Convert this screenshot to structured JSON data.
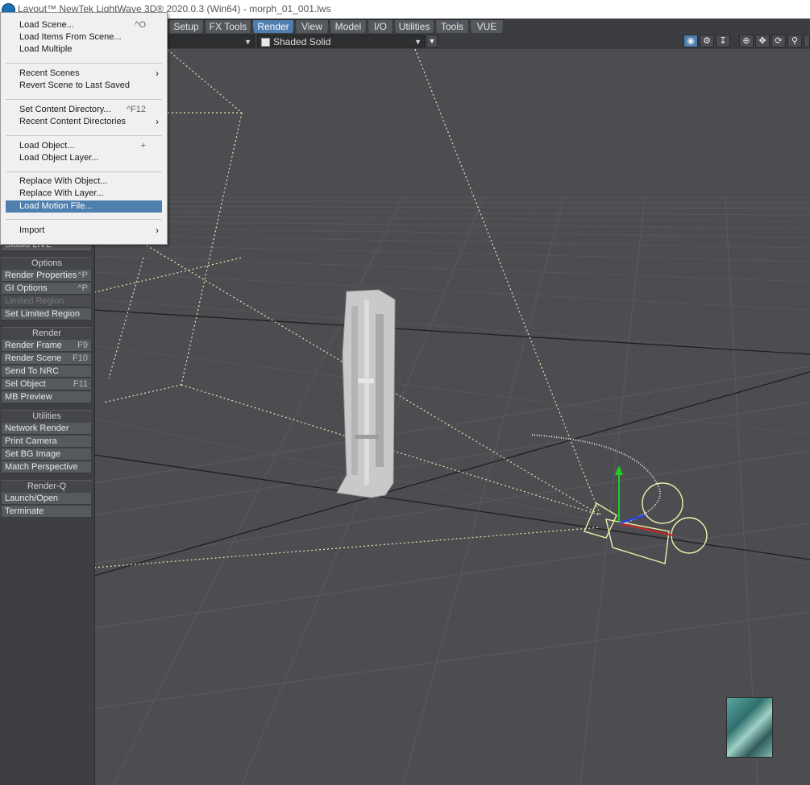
{
  "titlebar": {
    "title": "Layout™ NewTek LightWave 3D® 2020.0.3 (Win64) - morph_01_001.lws",
    "icon": "lightwave-logo-icon"
  },
  "tabs": [
    {
      "label": "Setup"
    },
    {
      "label": "FX Tools"
    },
    {
      "label": "Render"
    },
    {
      "label": "View"
    },
    {
      "label": "Model"
    },
    {
      "label": "I/O"
    },
    {
      "label": "Utilities"
    },
    {
      "label": "Tools"
    },
    {
      "label": "VUE"
    }
  ],
  "active_tab": "Render",
  "toolbar": {
    "view_select": "",
    "shading_select": "Shaded Solid",
    "icons": [
      "camera-render-icon",
      "gear-icon",
      "export-icon",
      "center-icon",
      "move-icon",
      "rotate-icon",
      "zoom-icon",
      "maximize-icon"
    ]
  },
  "menu": {
    "items": [
      {
        "label": "Load Scene...",
        "shortcut": "^O"
      },
      {
        "label": "Load Items From Scene...",
        "shortcut": ""
      },
      {
        "label": "Load Multiple",
        "shortcut": ""
      },
      {
        "label": "Recent Scenes",
        "shortcut": "",
        "submenu": true
      },
      {
        "label": "Revert Scene to Last Saved",
        "shortcut": ""
      },
      {
        "label": "Set Content Directory...",
        "shortcut": "^F12"
      },
      {
        "label": "Recent Content Directories",
        "shortcut": "",
        "submenu": true
      },
      {
        "label": "Load Object...",
        "shortcut": "+"
      },
      {
        "label": "Load Object Layer...",
        "shortcut": ""
      },
      {
        "label": "Replace With Object...",
        "shortcut": ""
      },
      {
        "label": "Replace With Layer...",
        "shortcut": ""
      },
      {
        "label": "Load Motion File...",
        "shortcut": ""
      },
      {
        "label": "Import",
        "shortcut": "",
        "submenu": true
      }
    ],
    "highlighted": "Load Motion File..."
  },
  "panel": {
    "partial_top": "Studio LIVE",
    "groups": [
      {
        "title": "Options",
        "buttons": [
          {
            "label": "Render Properties",
            "shortcut": "^P"
          },
          {
            "label": "GI Options",
            "shortcut": "^P"
          },
          {
            "label": "Limited Region",
            "shortcut": "",
            "disabled": true
          },
          {
            "label": "Set Limited Region",
            "shortcut": ""
          }
        ]
      },
      {
        "title": "Render",
        "buttons": [
          {
            "label": "Render Frame",
            "shortcut": "F9"
          },
          {
            "label": "Render Scene",
            "shortcut": "F10"
          },
          {
            "label": "Send To NRC",
            "shortcut": ""
          },
          {
            "label": "Sel Object",
            "shortcut": "F11"
          },
          {
            "label": "MB Preview",
            "shortcut": ""
          }
        ]
      },
      {
        "title": "Utilities",
        "buttons": [
          {
            "label": "Network Render",
            "shortcut": ""
          },
          {
            "label": "Print Camera",
            "shortcut": ""
          },
          {
            "label": "Set BG Image",
            "shortcut": ""
          },
          {
            "label": "Match Perspective",
            "shortcut": ""
          }
        ]
      },
      {
        "title": "Render-Q",
        "buttons": [
          {
            "label": "Launch/Open",
            "shortcut": ""
          },
          {
            "label": "Terminate",
            "shortcut": ""
          }
        ]
      }
    ]
  },
  "colors": {
    "accent": "#4f7fae",
    "grid": "#5a5c5f",
    "camera": "#ffffc0",
    "axis_y": "#22cc22",
    "axis_x": "#cc2222",
    "axis_z": "#2244ff"
  }
}
